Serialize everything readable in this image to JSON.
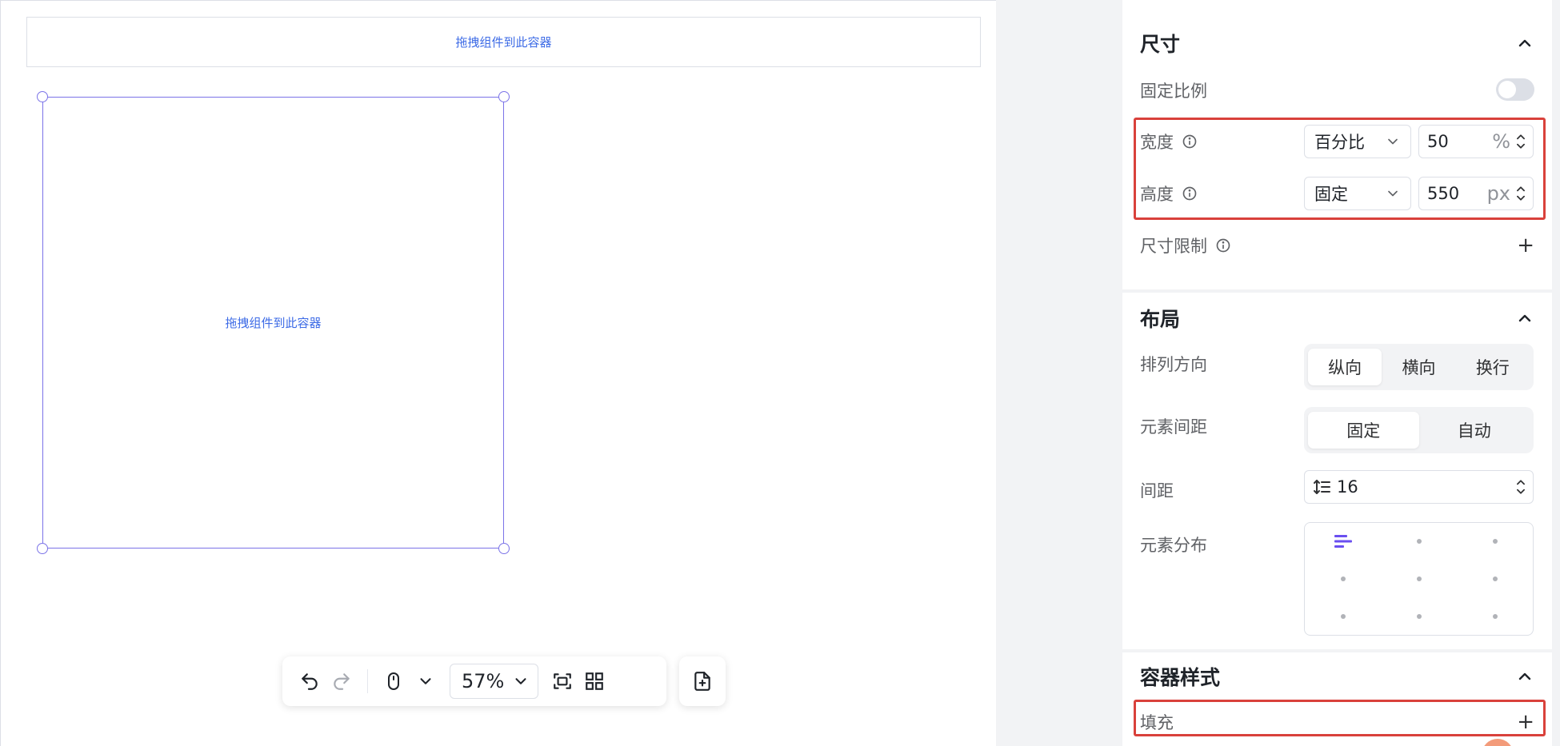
{
  "canvas": {
    "drop_hint_top": "拖拽组件到此容器",
    "drop_hint_selected": "拖拽组件到此容器"
  },
  "toolbar": {
    "zoom_value": "57%",
    "icons": [
      "undo-icon",
      "redo-icon",
      "mouse-icon",
      "chevron-down-icon",
      "fit-screen-icon",
      "grid-icon",
      "add-page-icon"
    ]
  },
  "size_section": {
    "title": "尺寸",
    "fixed_ratio_label": "固定比例",
    "fixed_ratio_on": false,
    "width_label": "宽度",
    "width_mode": "百分比",
    "width_value": "50",
    "width_unit": "%",
    "height_label": "高度",
    "height_mode": "固定",
    "height_value": "550",
    "height_unit": "px",
    "size_limit_label": "尺寸限制",
    "add_symbol": "+"
  },
  "layout_section": {
    "title": "布局",
    "direction_label": "排列方向",
    "direction_options": [
      "纵向",
      "横向",
      "换行"
    ],
    "direction_active": "纵向",
    "spacing_mode_label": "元素间距",
    "spacing_mode_options": [
      "固定",
      "自动"
    ],
    "spacing_mode_active": "固定",
    "gap_label": "间距",
    "gap_value": "16",
    "distribution_label": "元素分布"
  },
  "style_section": {
    "title": "容器样式",
    "fill_label": "填充",
    "add_symbol": "+"
  },
  "colors": {
    "accent": "#7b73e8",
    "link_blue": "#3d6be6",
    "highlight_red": "#d9413b"
  }
}
